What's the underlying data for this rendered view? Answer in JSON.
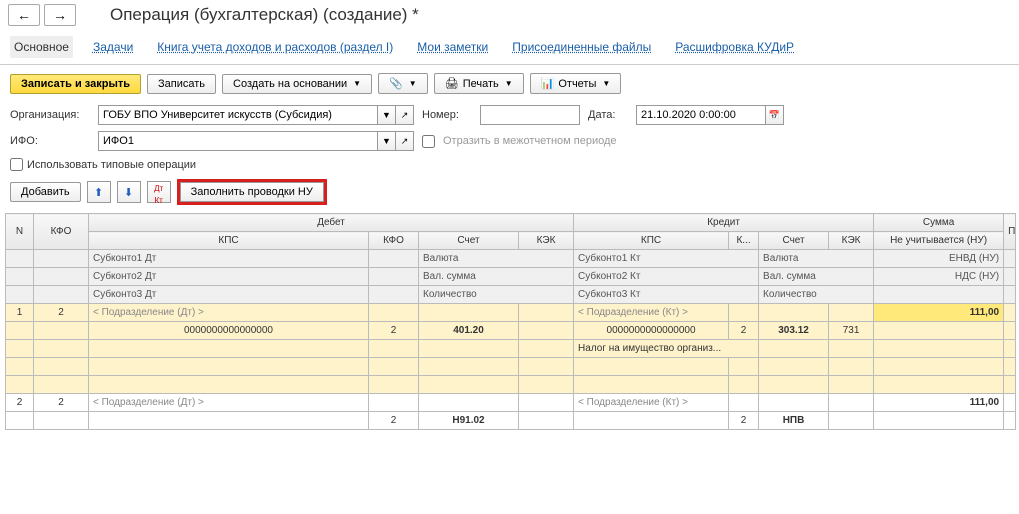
{
  "title": "Операция (бухгалтерская) (создание) *",
  "tabs": {
    "main": "Основное",
    "tasks": "Задачи",
    "book": "Книга учета доходов и расходов (раздел I)",
    "notes": "Мои заметки",
    "files": "Присоединенные файлы",
    "kudir": "Расшифровка КУДиР"
  },
  "toolbar": {
    "save_close": "Записать и закрыть",
    "save": "Записать",
    "create_based": "Создать на основании",
    "print": "Печать",
    "reports": "Отчеты"
  },
  "form": {
    "org_label": "Организация:",
    "org_value": "ГОБУ ВПО Университет искусств (Субсидия)",
    "ifo_label": "ИФО:",
    "ifo_value": "ИФО1",
    "num_label": "Номер:",
    "date_label": "Дата:",
    "date_value": "21.10.2020 0:00:00",
    "reflect": "Отразить в межотчетном периоде",
    "use_typical": "Использовать типовые операции"
  },
  "toolbar2": {
    "add": "Добавить",
    "fill_nu": "Заполнить проводки НУ"
  },
  "headers": {
    "n": "N",
    "kfo": "КФО",
    "debit": "Дебет",
    "credit": "Кредит",
    "sum": "Сумма",
    "p": "П",
    "kps": "КПС",
    "kfo2": "КФО",
    "acct": "Счет",
    "kek": "КЭК",
    "k": "К...",
    "not_counted": "Не учитывается (НУ)",
    "sk1dt": "Субконто1 Дт",
    "sk2dt": "Субконто2 Дт",
    "sk3dt": "Субконто3 Дт",
    "sk1kt": "Субконто1 Кт",
    "sk2kt": "Субконто2 Кт",
    "sk3kt": "Субконто3 Кт",
    "currency": "Валюта",
    "val_sum": "Вал. сумма",
    "qty": "Количество",
    "envd": "ЕНВД (НУ)",
    "nds": "НДС (НУ)",
    "dept_dt": "< Подразделение (Дт) >",
    "dept_kt": "< Подразделение (Кт) >"
  },
  "rows": [
    {
      "n": "1",
      "kfo": "2",
      "kps_dt": "0000000000000000",
      "kfo_dt": "2",
      "acct_dt": "401.20",
      "kps_kt": "0000000000000000",
      "k_kt": "2",
      "acct_kt": "303.12",
      "kek_kt": "731",
      "sum": "111,00",
      "note_kt": "Налог на имущество организ..."
    },
    {
      "n": "2",
      "kfo": "2",
      "kfo_dt": "2",
      "acct_dt": "Н91.02",
      "k_kt": "2",
      "acct_kt": "НПВ",
      "sum": "111,00"
    }
  ]
}
